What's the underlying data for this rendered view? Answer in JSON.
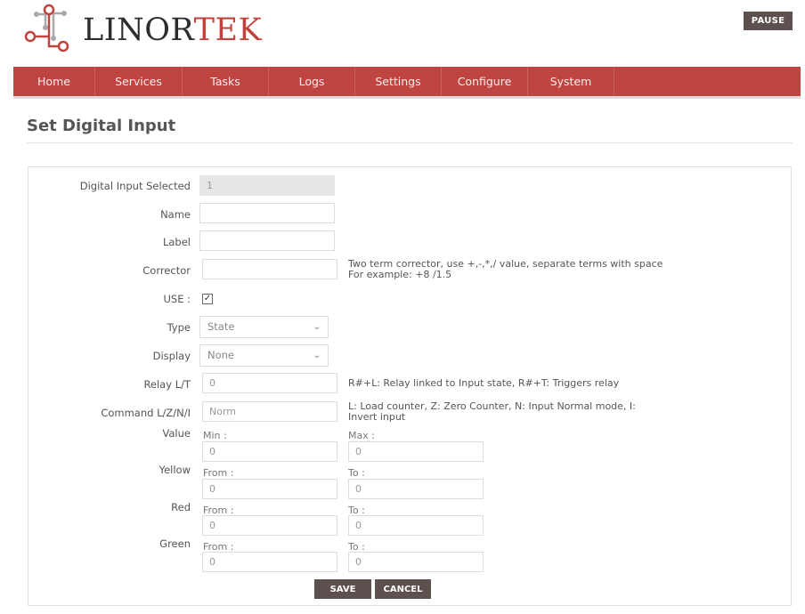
{
  "brand": {
    "name_part1": "LINOR",
    "name_part2": "TEK",
    "accent_color": "#bf4540"
  },
  "header": {
    "pause_label": "PAUSE"
  },
  "nav": {
    "items": [
      {
        "label": "Home"
      },
      {
        "label": "Services"
      },
      {
        "label": "Tasks"
      },
      {
        "label": "Logs"
      },
      {
        "label": "Settings"
      },
      {
        "label": "Configure"
      },
      {
        "label": "System"
      }
    ]
  },
  "page": {
    "title": "Set Digital Input"
  },
  "form": {
    "digital_input_selected": {
      "label": "Digital Input Selected",
      "value": "1"
    },
    "name": {
      "label": "Name",
      "value": ""
    },
    "label": {
      "label": "Label",
      "value": ""
    },
    "corrector": {
      "label": "Corrector",
      "value": "",
      "hint_line1": "Two term corrector, use +,-,*,/ value, separate terms with space",
      "hint_line2": "For example: +8 /1.5"
    },
    "use": {
      "label": "USE :",
      "checked": true,
      "check_glyph": "✓"
    },
    "type": {
      "label": "Type",
      "selected": "State"
    },
    "display": {
      "label": "Display",
      "selected": "None"
    },
    "relay": {
      "label": "Relay L/T",
      "value": "0",
      "hint": "R#+L: Relay linked to Input state, R#+T: Triggers relay"
    },
    "command": {
      "label": "Command L/Z/N/I",
      "value": "Norm",
      "hint_line1": "L: Load counter, Z: Zero Counter, N: Input Normal mode, I:",
      "hint_line2": "Invert input"
    },
    "value": {
      "label": "Value",
      "min_label": "Min :",
      "min": "0",
      "max_label": "Max :",
      "max": "0"
    },
    "yellow": {
      "label": "Yellow",
      "from_label": "From :",
      "from": "0",
      "to_label": "To :",
      "to": "0"
    },
    "red": {
      "label": "Red",
      "from_label": "From :",
      "from": "0",
      "to_label": "To :",
      "to": "0"
    },
    "green": {
      "label": "Green",
      "from_label": "From :",
      "from": "0",
      "to_label": "To :",
      "to": "0"
    },
    "save_label": "SAVE",
    "cancel_label": "CANCEL"
  },
  "icons": {
    "chevron": "⌄"
  }
}
